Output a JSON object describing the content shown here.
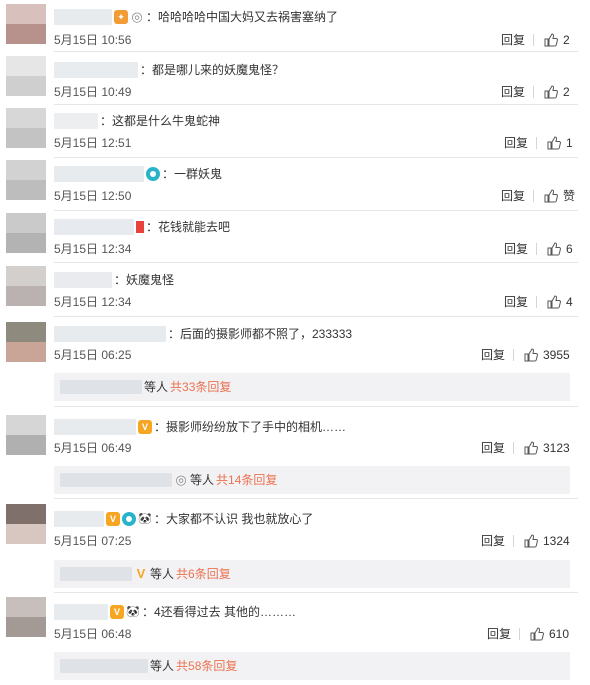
{
  "comments": [
    {
      "text": "：哈哈哈哈中国大妈又去祸害塞纳了",
      "time": "5月15日 10:56",
      "reply": "回复",
      "likes": "2"
    },
    {
      "text": "：都是哪儿来的妖魔鬼怪？",
      "time": "5月15日 10:49",
      "reply": "回复",
      "likes": "2"
    },
    {
      "text": "：这都是什么牛鬼蛇神",
      "time": "5月15日 12:51",
      "reply": "回复",
      "likes": "1"
    },
    {
      "text": "：一群妖鬼",
      "time": "5月15日 12:50",
      "reply": "回复",
      "likes": "赞"
    },
    {
      "text": "：花钱就能去吧",
      "time": "5月15日 12:34",
      "reply": "回复",
      "likes": "6"
    },
    {
      "text": "：妖魔鬼怪",
      "time": "5月15日 12:34",
      "reply": "回复",
      "likes": "4"
    },
    {
      "text": "：后面的摄影师都不照了，233333",
      "time": "5月15日 06:25",
      "reply": "回复",
      "likes": "3955",
      "sub": {
        "label": "等人",
        "link": "共33条回复"
      }
    },
    {
      "text": "：摄影师纷纷放下了手中的相机……",
      "time": "5月15日 06:49",
      "reply": "回复",
      "likes": "3123",
      "sub": {
        "label": "等人",
        "link": "共14条回复"
      }
    },
    {
      "text": "：大家都不认识 我也就放心了",
      "time": "5月15日 07:25",
      "reply": "回复",
      "likes": "1324",
      "sub": {
        "label": "等人",
        "link": "共6条回复"
      }
    },
    {
      "text": "：4还看得过去 其他的………",
      "time": "5月15日 06:48",
      "reply": "回复",
      "likes": "610",
      "sub": {
        "label": "等人",
        "link": "共58条回复"
      }
    }
  ],
  "icons": {
    "like": "thumbs-up-icon"
  },
  "colors": {
    "link": "#eb7350",
    "subreply_bg": "#f2f2f5",
    "divider": "#e6e6e6"
  }
}
